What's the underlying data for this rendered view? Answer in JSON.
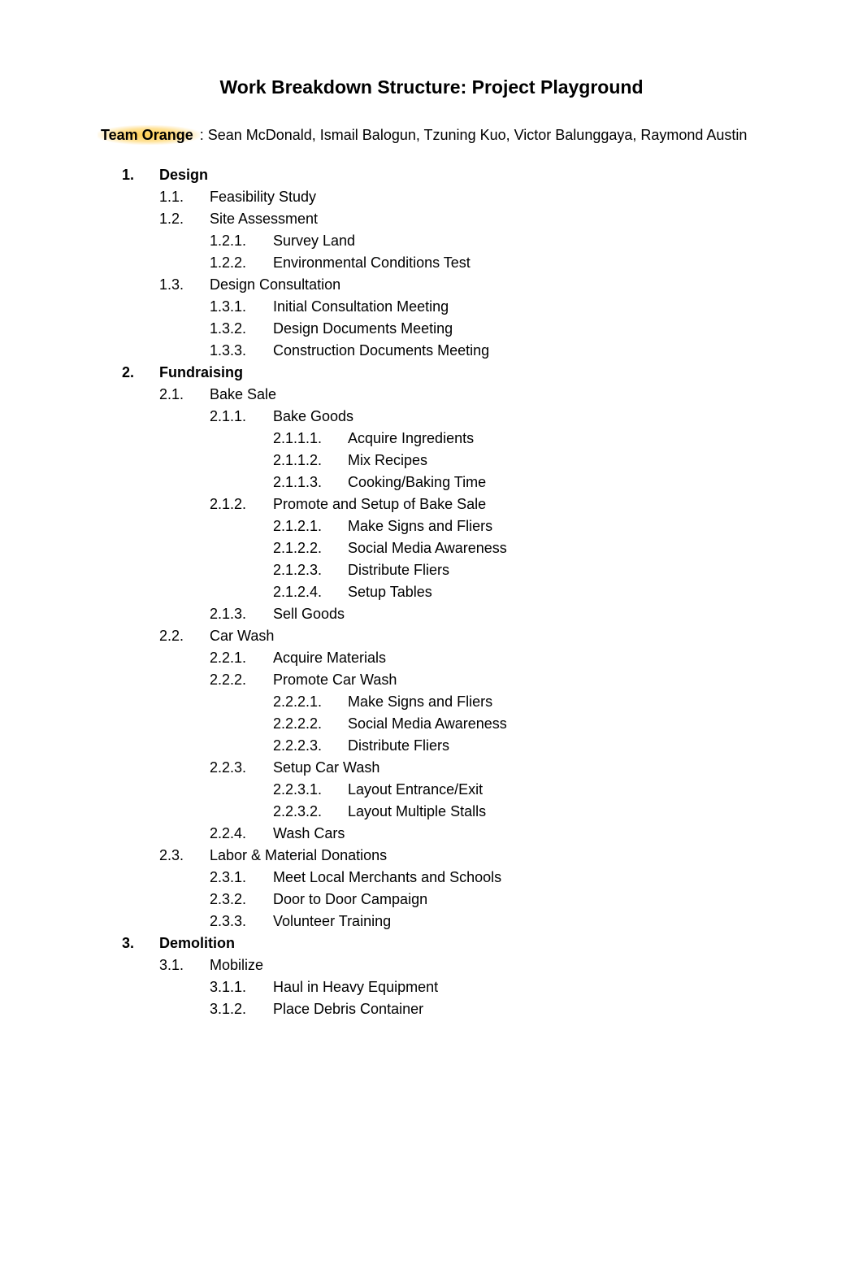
{
  "title": "Work Breakdown Structure: Project Playground",
  "team": {
    "label": "Team Orange",
    "members": ": Sean McDonald, Ismail Balogun, Tzuning Kuo, Victor Balunggaya, Raymond Austin"
  },
  "sections": [
    {
      "num": "1.",
      "title": "Design",
      "children": [
        {
          "num": "1.1.",
          "title": "Feasibility Study"
        },
        {
          "num": "1.2.",
          "title": "Site Assessment",
          "children": [
            {
              "num": "1.2.1.",
              "title": "Survey Land"
            },
            {
              "num": "1.2.2.",
              "title": "Environmental Conditions Test"
            }
          ]
        },
        {
          "num": "1.3.",
          "title": "Design Consultation",
          "children": [
            {
              "num": "1.3.1.",
              "title": "Initial Consultation Meeting"
            },
            {
              "num": "1.3.2.",
              "title": "Design Documents Meeting"
            },
            {
              "num": "1.3.3.",
              "title": "Construction Documents Meeting"
            }
          ]
        }
      ]
    },
    {
      "num": "2.",
      "title": "Fundraising",
      "children": [
        {
          "num": "2.1.",
          "title": "Bake Sale",
          "children": [
            {
              "num": "2.1.1.",
              "title": "Bake Goods",
              "children": [
                {
                  "num": "2.1.1.1.",
                  "title": "Acquire Ingredients"
                },
                {
                  "num": "2.1.1.2.",
                  "title": "Mix Recipes"
                },
                {
                  "num": "2.1.1.3.",
                  "title": "Cooking/Baking Time"
                }
              ]
            },
            {
              "num": "2.1.2.",
              "title": "Promote and Setup of Bake Sale",
              "children": [
                {
                  "num": "2.1.2.1.",
                  "title": "Make Signs and Fliers"
                },
                {
                  "num": "2.1.2.2.",
                  "title": "Social Media Awareness"
                },
                {
                  "num": "2.1.2.3.",
                  "title": "Distribute Fliers"
                },
                {
                  "num": "2.1.2.4.",
                  "title": "Setup Tables"
                }
              ]
            },
            {
              "num": "2.1.3.",
              "title": "Sell Goods"
            }
          ]
        },
        {
          "num": "2.2.",
          "title": "Car Wash",
          "children": [
            {
              "num": "2.2.1.",
              "title": "Acquire Materials"
            },
            {
              "num": "2.2.2.",
              "title": "Promote Car Wash",
              "children": [
                {
                  "num": "2.2.2.1.",
                  "title": "Make Signs and Fliers"
                },
                {
                  "num": "2.2.2.2.",
                  "title": "Social Media Awareness"
                },
                {
                  "num": "2.2.2.3.",
                  "title": "Distribute Fliers"
                }
              ]
            },
            {
              "num": "2.2.3.",
              "title": "Setup Car Wash",
              "children": [
                {
                  "num": "2.2.3.1.",
                  "title": "Layout Entrance/Exit"
                },
                {
                  "num": "2.2.3.2.",
                  "title": "Layout Multiple Stalls"
                }
              ]
            },
            {
              "num": "2.2.4.",
              "title": "Wash Cars"
            }
          ]
        },
        {
          "num": "2.3.",
          "title": "Labor & Material Donations",
          "children": [
            {
              "num": "2.3.1.",
              "title": "Meet Local Merchants and Schools"
            },
            {
              "num": "2.3.2.",
              "title": "Door to Door Campaign"
            },
            {
              "num": "2.3.3.",
              "title": "Volunteer Training"
            }
          ]
        }
      ]
    },
    {
      "num": "3.",
      "title": "Demolition",
      "children": [
        {
          "num": "3.1.",
          "title": "Mobilize",
          "children": [
            {
              "num": "3.1.1.",
              "title": "Haul in Heavy Equipment"
            },
            {
              "num": "3.1.2.",
              "title": "Place Debris Container"
            }
          ]
        }
      ]
    }
  ]
}
